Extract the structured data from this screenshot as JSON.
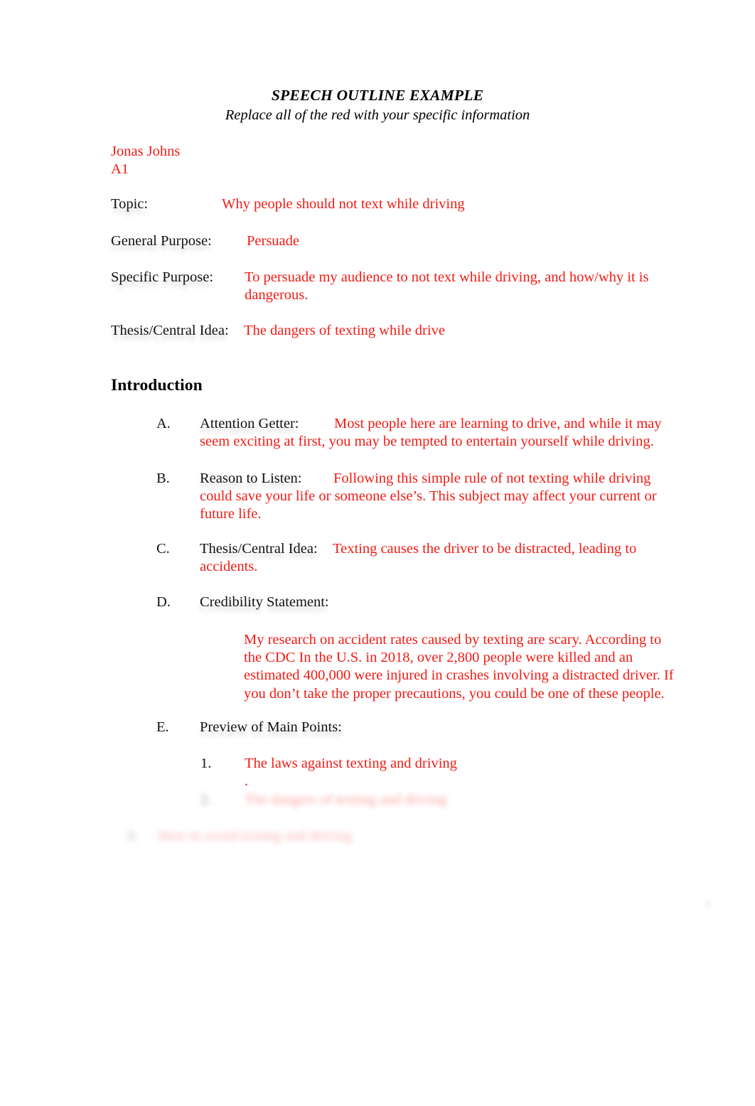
{
  "document": {
    "title": "SPEECH OUTLINE EXAMPLE",
    "subtitle": "Replace all of the red with your specific information",
    "colors": {
      "red_text": "#F21B14",
      "black_text": "#111111",
      "page_background": "#FFFFFF"
    },
    "header": {
      "student_name": "Jonas Johns",
      "section": "A1"
    },
    "fields": [
      {
        "label": "Topic:",
        "value": "Why people should not text while driving"
      },
      {
        "label": "General Purpose:",
        "value": "Persuade"
      },
      {
        "label": "Specific Purpose:",
        "value": "To persuade my audience to not text while driving, and how/why it is dangerous."
      },
      {
        "label": "Thesis/Central Idea:",
        "value": "The dangers of texting while drive"
      }
    ],
    "section_heading": "Introduction",
    "outline": [
      {
        "marker": "A.",
        "label": "Attention Getter:",
        "value": "Most people here are learning to drive, and while it may seem exciting at first, you may be tempted to entertain yourself while driving."
      },
      {
        "marker": "B.",
        "label": "Reason to Listen:",
        "value": "Following this simple rule of not texting while driving could save your life or someone else’s. This subject may affect your current or future life."
      },
      {
        "marker": "C.",
        "label": "Thesis/Central Idea:",
        "value": "Texting causes the driver to be distracted, leading to accidents."
      },
      {
        "marker": "D.",
        "label": "Credibility Statement:",
        "value": "My research on accident rates caused by texting are scary.   According to the CDC In the U.S. in 2018, over 2,800 people were killed and an estimated 400,000 were injured in crashes involving a distracted driver. If you don’t take the proper precautions, you could be one of these people."
      },
      {
        "marker": "E.",
        "label": "Preview of Main Points:",
        "value": ""
      }
    ],
    "main_points": [
      {
        "marker": "1.",
        "value": "The laws against texting and driving",
        "trailing": "."
      },
      {
        "marker": "2.",
        "value": "The dangers of texting and driving",
        "state": "faded"
      },
      {
        "marker": "3.",
        "value": "How to avoid texting and driving",
        "state": "faded"
      }
    ],
    "page_number": "1"
  }
}
